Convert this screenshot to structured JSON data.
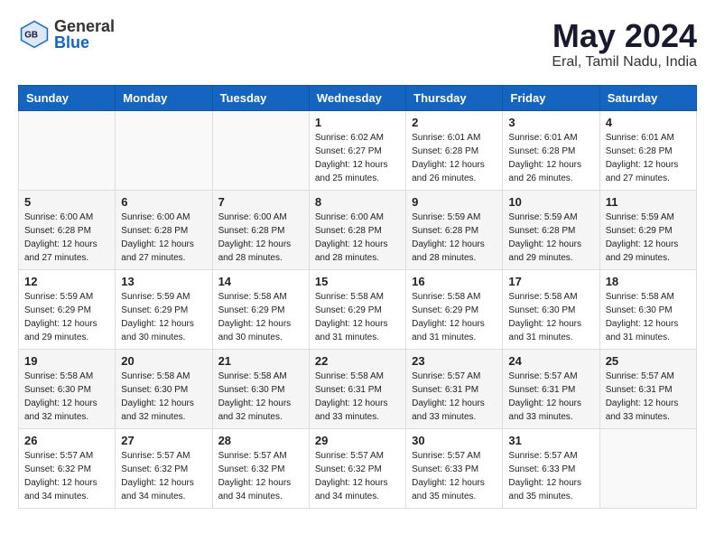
{
  "header": {
    "logo_line1": "General",
    "logo_line2": "Blue",
    "title": "May 2024",
    "subtitle": "Eral, Tamil Nadu, India"
  },
  "days_of_week": [
    "Sunday",
    "Monday",
    "Tuesday",
    "Wednesday",
    "Thursday",
    "Friday",
    "Saturday"
  ],
  "weeks": [
    [
      {
        "day": "",
        "sunrise": "",
        "sunset": "",
        "daylight": ""
      },
      {
        "day": "",
        "sunrise": "",
        "sunset": "",
        "daylight": ""
      },
      {
        "day": "",
        "sunrise": "",
        "sunset": "",
        "daylight": ""
      },
      {
        "day": "1",
        "sunrise": "Sunrise: 6:02 AM",
        "sunset": "Sunset: 6:27 PM",
        "daylight": "Daylight: 12 hours and 25 minutes."
      },
      {
        "day": "2",
        "sunrise": "Sunrise: 6:01 AM",
        "sunset": "Sunset: 6:28 PM",
        "daylight": "Daylight: 12 hours and 26 minutes."
      },
      {
        "day": "3",
        "sunrise": "Sunrise: 6:01 AM",
        "sunset": "Sunset: 6:28 PM",
        "daylight": "Daylight: 12 hours and 26 minutes."
      },
      {
        "day": "4",
        "sunrise": "Sunrise: 6:01 AM",
        "sunset": "Sunset: 6:28 PM",
        "daylight": "Daylight: 12 hours and 27 minutes."
      }
    ],
    [
      {
        "day": "5",
        "sunrise": "Sunrise: 6:00 AM",
        "sunset": "Sunset: 6:28 PM",
        "daylight": "Daylight: 12 hours and 27 minutes."
      },
      {
        "day": "6",
        "sunrise": "Sunrise: 6:00 AM",
        "sunset": "Sunset: 6:28 PM",
        "daylight": "Daylight: 12 hours and 27 minutes."
      },
      {
        "day": "7",
        "sunrise": "Sunrise: 6:00 AM",
        "sunset": "Sunset: 6:28 PM",
        "daylight": "Daylight: 12 hours and 28 minutes."
      },
      {
        "day": "8",
        "sunrise": "Sunrise: 6:00 AM",
        "sunset": "Sunset: 6:28 PM",
        "daylight": "Daylight: 12 hours and 28 minutes."
      },
      {
        "day": "9",
        "sunrise": "Sunrise: 5:59 AM",
        "sunset": "Sunset: 6:28 PM",
        "daylight": "Daylight: 12 hours and 28 minutes."
      },
      {
        "day": "10",
        "sunrise": "Sunrise: 5:59 AM",
        "sunset": "Sunset: 6:28 PM",
        "daylight": "Daylight: 12 hours and 29 minutes."
      },
      {
        "day": "11",
        "sunrise": "Sunrise: 5:59 AM",
        "sunset": "Sunset: 6:29 PM",
        "daylight": "Daylight: 12 hours and 29 minutes."
      }
    ],
    [
      {
        "day": "12",
        "sunrise": "Sunrise: 5:59 AM",
        "sunset": "Sunset: 6:29 PM",
        "daylight": "Daylight: 12 hours and 29 minutes."
      },
      {
        "day": "13",
        "sunrise": "Sunrise: 5:59 AM",
        "sunset": "Sunset: 6:29 PM",
        "daylight": "Daylight: 12 hours and 30 minutes."
      },
      {
        "day": "14",
        "sunrise": "Sunrise: 5:58 AM",
        "sunset": "Sunset: 6:29 PM",
        "daylight": "Daylight: 12 hours and 30 minutes."
      },
      {
        "day": "15",
        "sunrise": "Sunrise: 5:58 AM",
        "sunset": "Sunset: 6:29 PM",
        "daylight": "Daylight: 12 hours and 31 minutes."
      },
      {
        "day": "16",
        "sunrise": "Sunrise: 5:58 AM",
        "sunset": "Sunset: 6:29 PM",
        "daylight": "Daylight: 12 hours and 31 minutes."
      },
      {
        "day": "17",
        "sunrise": "Sunrise: 5:58 AM",
        "sunset": "Sunset: 6:30 PM",
        "daylight": "Daylight: 12 hours and 31 minutes."
      },
      {
        "day": "18",
        "sunrise": "Sunrise: 5:58 AM",
        "sunset": "Sunset: 6:30 PM",
        "daylight": "Daylight: 12 hours and 31 minutes."
      }
    ],
    [
      {
        "day": "19",
        "sunrise": "Sunrise: 5:58 AM",
        "sunset": "Sunset: 6:30 PM",
        "daylight": "Daylight: 12 hours and 32 minutes."
      },
      {
        "day": "20",
        "sunrise": "Sunrise: 5:58 AM",
        "sunset": "Sunset: 6:30 PM",
        "daylight": "Daylight: 12 hours and 32 minutes."
      },
      {
        "day": "21",
        "sunrise": "Sunrise: 5:58 AM",
        "sunset": "Sunset: 6:30 PM",
        "daylight": "Daylight: 12 hours and 32 minutes."
      },
      {
        "day": "22",
        "sunrise": "Sunrise: 5:58 AM",
        "sunset": "Sunset: 6:31 PM",
        "daylight": "Daylight: 12 hours and 33 minutes."
      },
      {
        "day": "23",
        "sunrise": "Sunrise: 5:57 AM",
        "sunset": "Sunset: 6:31 PM",
        "daylight": "Daylight: 12 hours and 33 minutes."
      },
      {
        "day": "24",
        "sunrise": "Sunrise: 5:57 AM",
        "sunset": "Sunset: 6:31 PM",
        "daylight": "Daylight: 12 hours and 33 minutes."
      },
      {
        "day": "25",
        "sunrise": "Sunrise: 5:57 AM",
        "sunset": "Sunset: 6:31 PM",
        "daylight": "Daylight: 12 hours and 33 minutes."
      }
    ],
    [
      {
        "day": "26",
        "sunrise": "Sunrise: 5:57 AM",
        "sunset": "Sunset: 6:32 PM",
        "daylight": "Daylight: 12 hours and 34 minutes."
      },
      {
        "day": "27",
        "sunrise": "Sunrise: 5:57 AM",
        "sunset": "Sunset: 6:32 PM",
        "daylight": "Daylight: 12 hours and 34 minutes."
      },
      {
        "day": "28",
        "sunrise": "Sunrise: 5:57 AM",
        "sunset": "Sunset: 6:32 PM",
        "daylight": "Daylight: 12 hours and 34 minutes."
      },
      {
        "day": "29",
        "sunrise": "Sunrise: 5:57 AM",
        "sunset": "Sunset: 6:32 PM",
        "daylight": "Daylight: 12 hours and 34 minutes."
      },
      {
        "day": "30",
        "sunrise": "Sunrise: 5:57 AM",
        "sunset": "Sunset: 6:33 PM",
        "daylight": "Daylight: 12 hours and 35 minutes."
      },
      {
        "day": "31",
        "sunrise": "Sunrise: 5:57 AM",
        "sunset": "Sunset: 6:33 PM",
        "daylight": "Daylight: 12 hours and 35 minutes."
      },
      {
        "day": "",
        "sunrise": "",
        "sunset": "",
        "daylight": ""
      }
    ]
  ]
}
